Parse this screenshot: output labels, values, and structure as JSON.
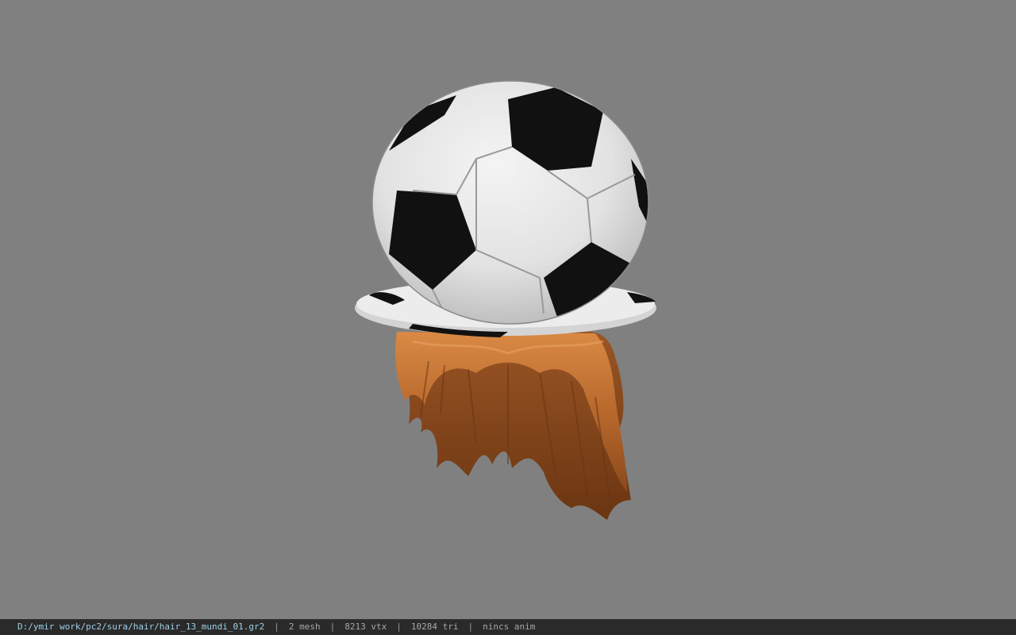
{
  "viewport": {
    "background": "#808080",
    "model_description_icon": "soccer-ball-hat-with-hair"
  },
  "statusbar": {
    "file_path": "D:/ymir work/pc2/sura/hair/hair_13_mundi_01.gr2",
    "separator": "|",
    "mesh": "2 mesh",
    "vertices": "8213 vtx",
    "triangles": "10284 tri",
    "anim": "nincs anim"
  },
  "colors": {
    "statusbar_bg": "#2a2a2a",
    "path_text": "#9fd0e8",
    "stat_text": "#a8a8a8",
    "ball_white": "#e8e8e8",
    "ball_black": "#111111",
    "hair": "#c87a3a"
  }
}
